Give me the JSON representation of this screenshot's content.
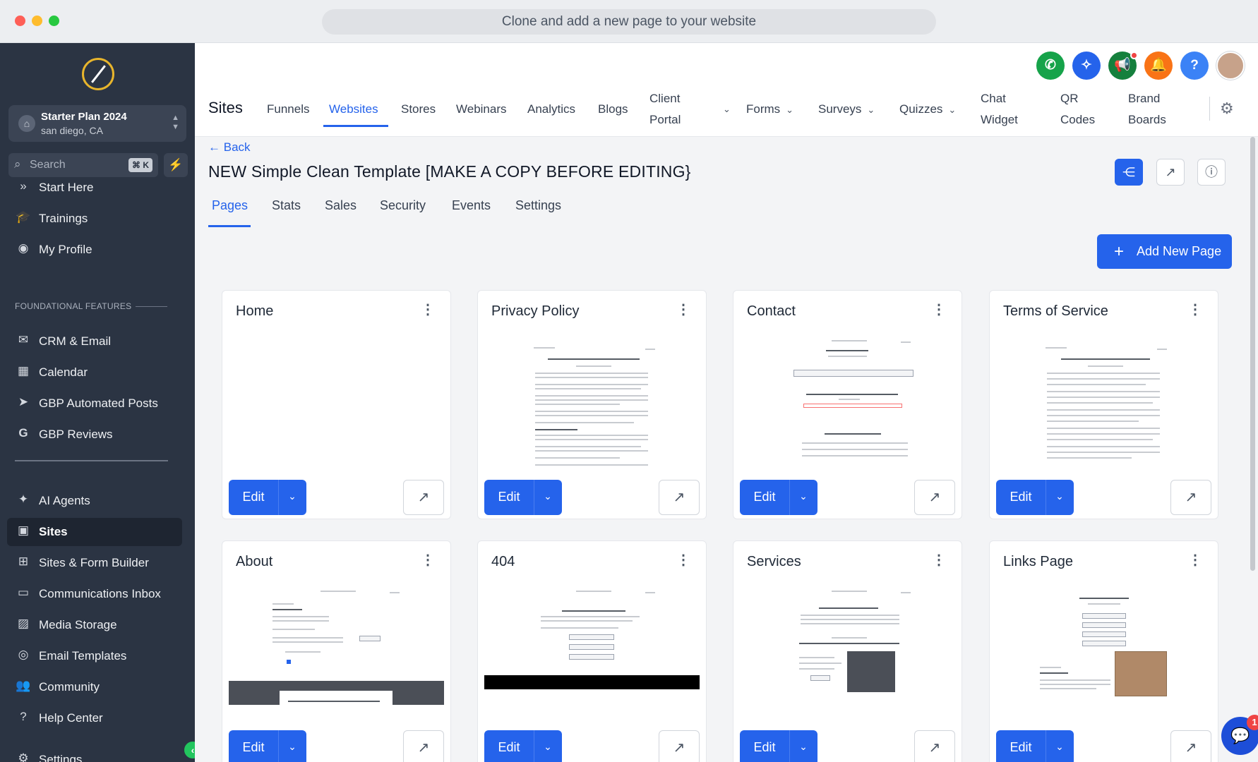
{
  "window": {
    "title": "Clone and add a new page to your website"
  },
  "sidebar": {
    "account": {
      "name": "Starter Plan 2024",
      "location": "san diego, CA"
    },
    "search": {
      "placeholder": "Search",
      "shortcut": "⌘ K"
    },
    "section_label": "FOUNDATIONAL FEATURES",
    "items": [
      {
        "label": "Start Here",
        "icon": "double-chevron-icon"
      },
      {
        "label": "Trainings",
        "icon": "graduation-cap-icon"
      },
      {
        "label": "My Profile",
        "icon": "user-circle-icon"
      },
      {
        "label": "CRM & Email",
        "icon": "mail-icon"
      },
      {
        "label": "Calendar",
        "icon": "calendar-icon"
      },
      {
        "label": "GBP Automated Posts",
        "icon": "send-icon"
      },
      {
        "label": "GBP Reviews",
        "icon": "google-icon"
      },
      {
        "label": "AI Agents",
        "icon": "sparkle-icon"
      },
      {
        "label": "Sites",
        "icon": "sites-icon",
        "active": true
      },
      {
        "label": "Sites & Form Builder",
        "icon": "sitemap-icon"
      },
      {
        "label": "Communications Inbox",
        "icon": "inbox-icon"
      },
      {
        "label": "Media Storage",
        "icon": "image-icon"
      },
      {
        "label": "Email Templates",
        "icon": "play-circle-icon"
      },
      {
        "label": "Community",
        "icon": "users-icon"
      },
      {
        "label": "Help Center",
        "icon": "question-icon"
      },
      {
        "label": "Settings",
        "icon": "gear-icon"
      }
    ]
  },
  "topbar": {
    "section_title": "Sites",
    "nav": [
      {
        "label": "Funnels"
      },
      {
        "label": "Websites",
        "active": true
      },
      {
        "label": "Stores"
      },
      {
        "label": "Webinars"
      },
      {
        "label": "Analytics"
      },
      {
        "label": "Blogs"
      },
      {
        "label": "Client Portal",
        "line1": "Client",
        "line2": "Portal",
        "dropdown": true
      },
      {
        "label": "Forms",
        "dropdown": true
      },
      {
        "label": "Surveys",
        "dropdown": true
      },
      {
        "label": "Quizzes",
        "dropdown": true
      },
      {
        "label": "Chat Widget",
        "line1": "Chat",
        "line2": "Widget"
      },
      {
        "label": "QR Codes",
        "line1": "QR",
        "line2": "Codes"
      },
      {
        "label": "Brand Boards",
        "line1": "Brand",
        "line2": "Boards"
      }
    ]
  },
  "page": {
    "back_label": "Back",
    "title": "NEW Simple Clean Template [MAKE A COPY BEFORE EDITING}",
    "tabs": [
      "Pages",
      "Stats",
      "Sales",
      "Security",
      "Events",
      "Settings"
    ],
    "add_page_label": "Add New Page",
    "edit_label": "Edit",
    "cards": [
      {
        "title": "Home"
      },
      {
        "title": "Privacy Policy"
      },
      {
        "title": "Contact"
      },
      {
        "title": "Terms of Service"
      },
      {
        "title": "About"
      },
      {
        "title": "404"
      },
      {
        "title": "Services"
      },
      {
        "title": "Links Page"
      }
    ]
  },
  "chat": {
    "badge_count": "1"
  },
  "colors": {
    "accent": "#2563eb",
    "sidebar": "#2b3443",
    "success": "#22c55e"
  }
}
